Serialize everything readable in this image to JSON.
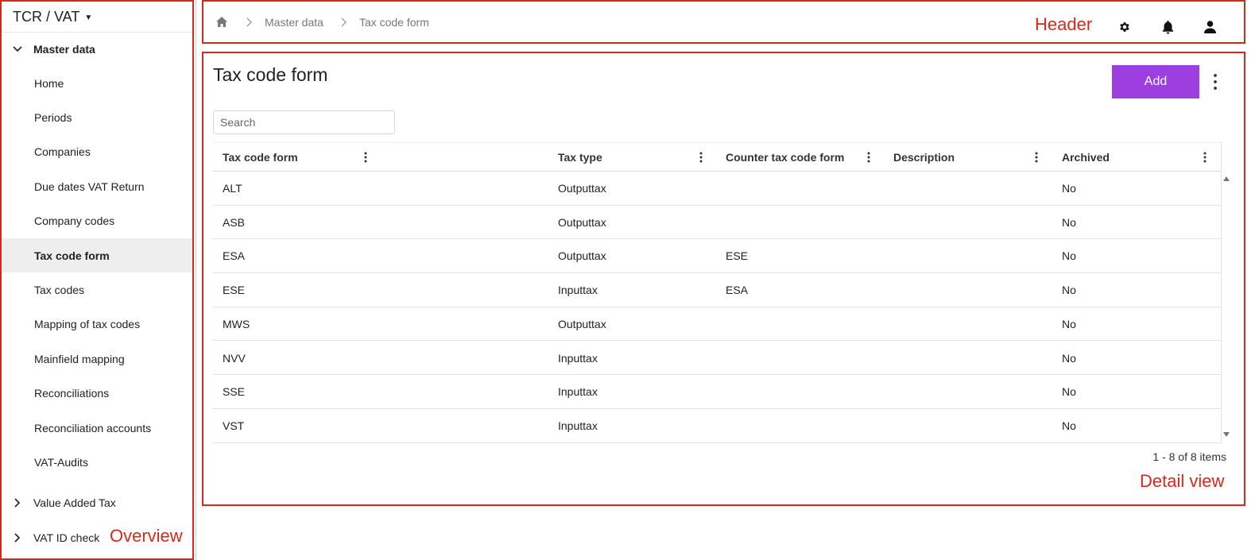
{
  "sidebar": {
    "app_name": "TCR / VAT",
    "group_master": "Master data",
    "items": [
      {
        "label": "Home"
      },
      {
        "label": "Periods"
      },
      {
        "label": "Companies"
      },
      {
        "label": "Due dates VAT Return"
      },
      {
        "label": "Company codes"
      },
      {
        "label": "Tax code form",
        "active": true
      },
      {
        "label": "Tax codes"
      },
      {
        "label": "Mapping of tax codes"
      },
      {
        "label": "Mainfield mapping"
      },
      {
        "label": "Reconciliations"
      },
      {
        "label": "Reconciliation accounts"
      },
      {
        "label": "VAT-Audits"
      }
    ],
    "group_vat": "Value Added Tax",
    "group_vatid": "VAT ID check",
    "region_label": "Overview"
  },
  "header": {
    "breadcrumb": [
      "Master data",
      "Tax code form"
    ],
    "region_label": "Header",
    "icons": [
      "home-icon",
      "gear-icon",
      "bell-icon",
      "user-icon"
    ]
  },
  "detail": {
    "title": "Tax code form",
    "add_label": "Add",
    "search_placeholder": "Search",
    "region_label": "Detail view",
    "columns": [
      "Tax code form",
      "Tax type",
      "Counter tax code form",
      "Description",
      "Archived"
    ],
    "rows": [
      [
        "ALT",
        "Outputtax",
        "",
        "",
        "No"
      ],
      [
        "ASB",
        "Outputtax",
        "",
        "",
        "No"
      ],
      [
        "ESA",
        "Outputtax",
        "ESE",
        "",
        "No"
      ],
      [
        "ESE",
        "Inputtax",
        "ESA",
        "",
        "No"
      ],
      [
        "MWS",
        "Outputtax",
        "",
        "",
        "No"
      ],
      [
        "NVV",
        "Inputtax",
        "",
        "",
        "No"
      ],
      [
        "SSE",
        "Inputtax",
        "",
        "",
        "No"
      ],
      [
        "VST",
        "Inputtax",
        "",
        "",
        "No"
      ]
    ],
    "pager_text": "1 - 8 of 8 items"
  },
  "colors": {
    "accent": "#9d3ee0",
    "annotation": "#d8281b",
    "active_nav_bg": "#eeeeee"
  }
}
